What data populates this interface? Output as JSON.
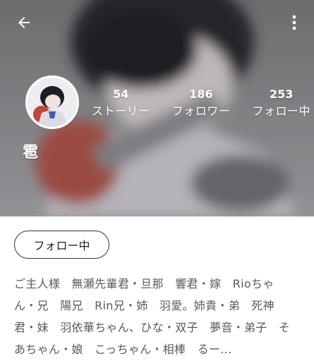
{
  "header": {
    "back_icon": "arrow-left-icon",
    "menu_icon": "more-vertical-icon"
  },
  "profile": {
    "username": "雹",
    "stats": [
      {
        "value": "54",
        "label": "ストーリー"
      },
      {
        "value": "186",
        "label": "フォロワー"
      },
      {
        "value": "253",
        "label": "フォロー中"
      }
    ],
    "follow_button": "フォロー中",
    "bio": "ご主人様　無瀬先輩君・旦那　響君・嫁　Rioちゃん・兄　陽兄　Rin兄・姉　羽愛。姉貴・弟　死神君・妹　羽依華ちゃん、ひな・双子　夢音・弟子　そあちゃん・娘　こっちゃん・相棒　るー..."
  },
  "colors": {
    "cover_tint": "#8d8c8e",
    "text_on_cover": "#ffffff",
    "bio_text": "#5a5a5a",
    "button_border": "#333333"
  }
}
